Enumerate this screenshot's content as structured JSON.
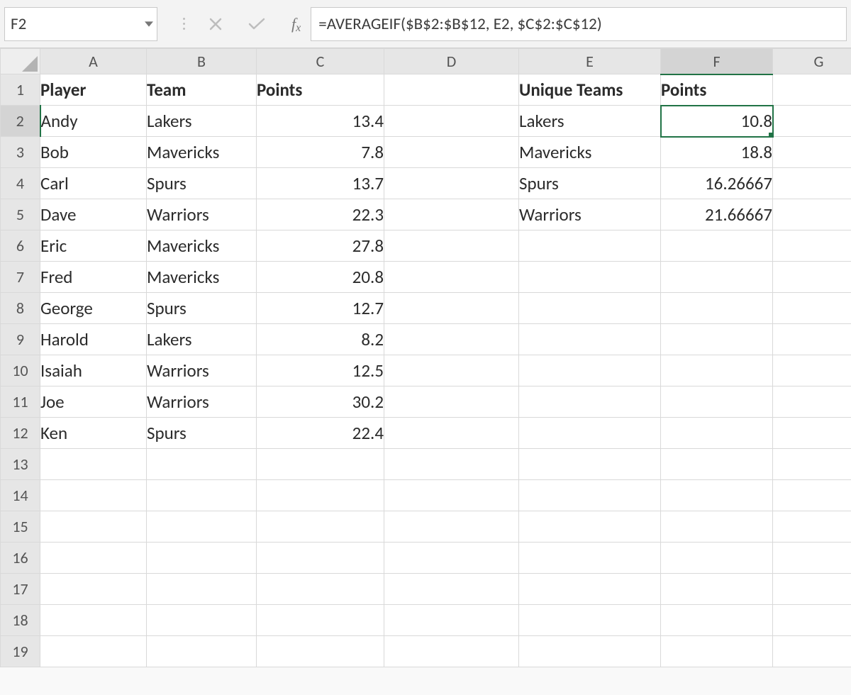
{
  "name_box": {
    "value": "F2"
  },
  "formula_bar": {
    "formula": "=AVERAGEIF($B$2:$B$12, E2, $C$2:$C$12)"
  },
  "columns": [
    "A",
    "B",
    "C",
    "D",
    "E",
    "F",
    "G"
  ],
  "row_count": 19,
  "selected_cell": "F2",
  "cells": {
    "A1": {
      "v": "Player",
      "b": true
    },
    "B1": {
      "v": "Team",
      "b": true
    },
    "C1": {
      "v": "Points",
      "b": true
    },
    "E1": {
      "v": "Unique Teams",
      "b": true
    },
    "F1": {
      "v": "Points",
      "b": true
    },
    "A2": {
      "v": "Andy"
    },
    "B2": {
      "v": "Lakers"
    },
    "C2": {
      "v": "13.4",
      "r": true
    },
    "A3": {
      "v": "Bob"
    },
    "B3": {
      "v": "Mavericks"
    },
    "C3": {
      "v": "7.8",
      "r": true
    },
    "A4": {
      "v": "Carl"
    },
    "B4": {
      "v": "Spurs"
    },
    "C4": {
      "v": "13.7",
      "r": true
    },
    "A5": {
      "v": "Dave"
    },
    "B5": {
      "v": "Warriors"
    },
    "C5": {
      "v": "22.3",
      "r": true
    },
    "A6": {
      "v": "Eric"
    },
    "B6": {
      "v": "Mavericks"
    },
    "C6": {
      "v": "27.8",
      "r": true
    },
    "A7": {
      "v": "Fred"
    },
    "B7": {
      "v": "Mavericks"
    },
    "C7": {
      "v": "20.8",
      "r": true
    },
    "A8": {
      "v": "George"
    },
    "B8": {
      "v": "Spurs"
    },
    "C8": {
      "v": "12.7",
      "r": true
    },
    "A9": {
      "v": "Harold"
    },
    "B9": {
      "v": "Lakers"
    },
    "C9": {
      "v": "8.2",
      "r": true
    },
    "A10": {
      "v": "Isaiah"
    },
    "B10": {
      "v": "Warriors"
    },
    "C10": {
      "v": "12.5",
      "r": true
    },
    "A11": {
      "v": "Joe"
    },
    "B11": {
      "v": "Warriors"
    },
    "C11": {
      "v": "30.2",
      "r": true
    },
    "A12": {
      "v": "Ken"
    },
    "B12": {
      "v": "Spurs"
    },
    "C12": {
      "v": "22.4",
      "r": true
    },
    "E2": {
      "v": "Lakers"
    },
    "F2": {
      "v": "10.8",
      "r": true
    },
    "E3": {
      "v": "Mavericks"
    },
    "F3": {
      "v": "18.8",
      "r": true
    },
    "E4": {
      "v": "Spurs"
    },
    "F4": {
      "v": "16.26667",
      "r": true
    },
    "E5": {
      "v": "Warriors"
    },
    "F5": {
      "v": "21.66667",
      "r": true
    }
  },
  "column_widths": {
    "A": 150,
    "B": 155,
    "C": 180,
    "D": 190,
    "E": 200,
    "F": 158,
    "G": 130
  }
}
